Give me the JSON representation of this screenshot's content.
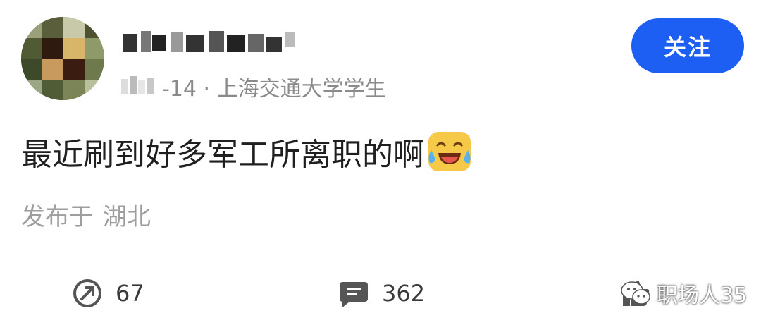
{
  "post": {
    "date_suffix": "-14 · 上海交通大学学生",
    "follow_label": "关注",
    "text": "最近刷到好多军工所离职的啊",
    "location_prefix": "发布于",
    "location": "湖北"
  },
  "actions": {
    "share_count": "67",
    "comment_count": "362"
  },
  "watermark": {
    "text": "职场人35"
  },
  "icons": {
    "avatar": "avatar-pixelated",
    "emoji": "tears-of-joy-emoji",
    "share": "share-icon",
    "comment": "comment-icon",
    "like": "like-icon",
    "wechat": "wechat-icon"
  },
  "colors": {
    "accent": "#1d5ff2",
    "meta_text": "#8a8a8a",
    "location_text": "#9e9e9e"
  }
}
